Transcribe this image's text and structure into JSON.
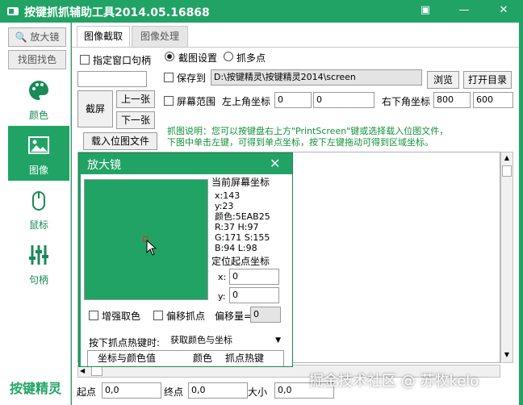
{
  "app": {
    "title": "按键抓抓辅助工具2014.05.16868"
  },
  "sidebar": {
    "magnifier_btn": "放大镜",
    "find_pic_btn": "找图找色",
    "items": [
      {
        "label": "颜色",
        "icon": "palette-icon"
      },
      {
        "label": "图像",
        "icon": "image-icon"
      },
      {
        "label": "鼠标",
        "icon": "mouse-icon"
      },
      {
        "label": "句柄",
        "icon": "sliders-icon"
      }
    ],
    "brand": "按键精灵"
  },
  "tabs": [
    "图像截取",
    "图像处理"
  ],
  "capture": {
    "specify_handle": "指定窗口句柄",
    "radio_capture_settings": "截图设置",
    "radio_multi_points": "抓多点",
    "save_to": "保存到",
    "save_path": "D:\\按键精灵\\按键精灵2014\\screen",
    "browse": "浏览",
    "open_dir": "打开目录",
    "screenshot": "截屏",
    "prev": "上一张",
    "next": "下一张",
    "screen_range": "屏幕范围",
    "top_left": "左上角坐标",
    "top_left_x": "0",
    "top_left_y": "0",
    "bottom_right": "右下角坐标",
    "bottom_right_x": "800",
    "bottom_right_y": "600",
    "load_bitmap": "载入位图文件",
    "hint_line1": "抓图说明：您可以按键盘右上方\"PrintScreen\"键或选择载入位图文件，",
    "hint_line2": "下图中单击左键，可得到单点坐标，按下左键拖动可得到区域坐标。"
  },
  "magnifier": {
    "title": "放大镜",
    "close": "✕",
    "screen_coords_label": "当前屏幕坐标",
    "x": "x:143",
    "y": "y:23",
    "color": "颜色:5EAB25",
    "r_h": "R:37  H:97",
    "g_s": "G:171  S:155",
    "b_l": "B:94  L:98",
    "origin_label": "定位起点坐标",
    "origin_x_label": "x:",
    "origin_x": "0",
    "origin_y_label": "y:",
    "origin_y": "0",
    "enhance": "增强取色",
    "offset_point": "偏移抓点",
    "offset_amount": "偏移量=",
    "offset_value": "0",
    "hotkey_label": "按下抓点热键时:",
    "hotkey_value": "获取颜色与坐标",
    "coord_color_header": "坐标与颜色值",
    "color_header": "颜色",
    "hotkey_header": "抓点热键"
  },
  "bottom": {
    "start_label": "起点",
    "start_value": "0,0",
    "end_label": "终点",
    "end_value": "0,0",
    "size_label": "大小",
    "size_value": "0,0"
  },
  "watermark": "掘金技术社区 @ 苏牧kelo"
}
